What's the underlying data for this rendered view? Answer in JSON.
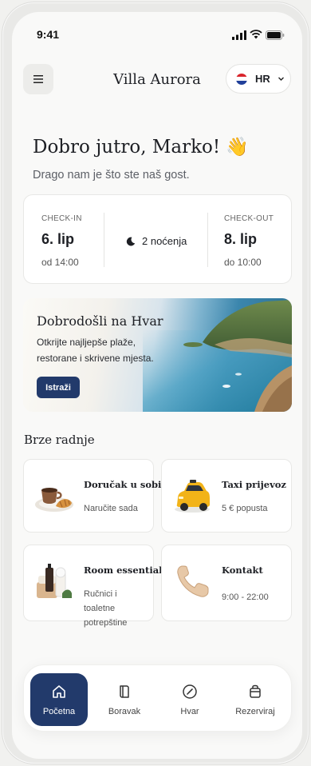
{
  "status_bar": {
    "time": "9:41"
  },
  "header": {
    "title": "Villa Aurora",
    "language": "HR",
    "menu_icon": "menu-icon"
  },
  "greeting": {
    "title": "Dobro jutro, Marko! 👋",
    "subtitle": "Drago nam je što ste naš gost."
  },
  "stay": {
    "checkin_label": "CHECK-IN",
    "checkin_date": "6. lip",
    "checkin_time": "od 14:00",
    "nights": "2 noćenja",
    "checkout_label": "CHECK-OUT",
    "checkout_date": "8. lip",
    "checkout_time": "do 10:00"
  },
  "banner": {
    "title": "Dobrodošli na Hvar",
    "text": "Otkrijte najljepše plaže, restorane i skrivene mjesta.",
    "button": "Istraži"
  },
  "quick_actions": {
    "title": "Brze radnje",
    "items": [
      {
        "title": "Doručak u sobi",
        "subtitle": "Naručite sada",
        "icon": "breakfast-icon"
      },
      {
        "title": "Taxi prijevoz",
        "subtitle": "5 € popusta",
        "icon": "taxi-icon"
      },
      {
        "title": "Room essentials",
        "subtitle": "Ručnici i toaletne potrepštine",
        "icon": "essentials-icon"
      },
      {
        "title": "Kontakt",
        "subtitle": "9:00 - 22:00",
        "icon": "phone-icon"
      }
    ]
  },
  "tabbar": {
    "items": [
      {
        "label": "Početna",
        "icon": "home-icon",
        "active": true
      },
      {
        "label": "Boravak",
        "icon": "book-icon",
        "active": false
      },
      {
        "label": "Hvar",
        "icon": "compass-icon",
        "active": false
      },
      {
        "label": "Rezerviraj",
        "icon": "bag-icon",
        "active": false
      }
    ]
  },
  "colors": {
    "accent": "#223a6b",
    "background": "#f9f9f8",
    "card": "#ffffff"
  }
}
